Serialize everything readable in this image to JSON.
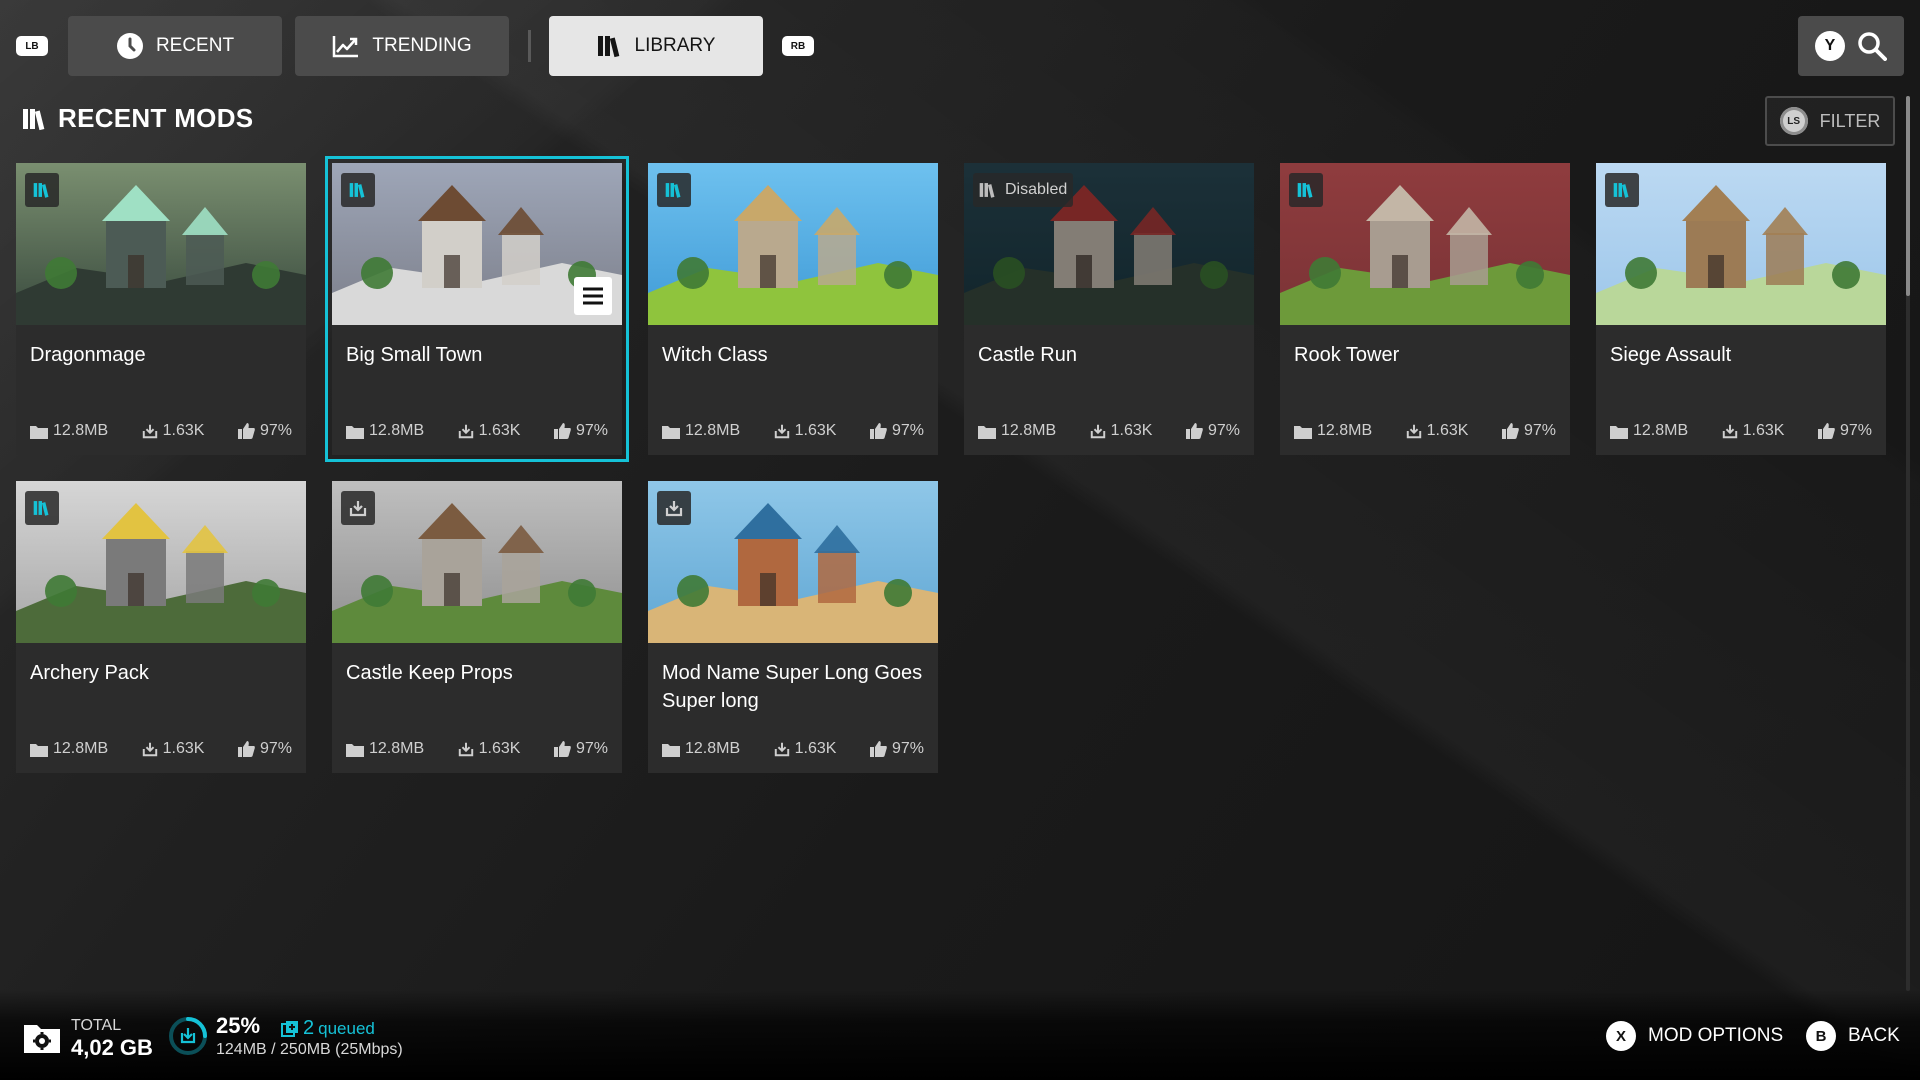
{
  "topbar": {
    "left_bumper": "LB",
    "right_bumper": "RB",
    "tabs": [
      {
        "label": "RECENT",
        "icon": "clock-icon",
        "active": false
      },
      {
        "label": "TRENDING",
        "icon": "trending-chart-icon",
        "active": false
      },
      {
        "label": "LIBRARY",
        "icon": "library-books-icon",
        "active": true
      }
    ],
    "search_button_glyph": "Y"
  },
  "section": {
    "title": "RECENT MODS",
    "filter_label": "FILTER",
    "filter_glyph": "LS"
  },
  "mods": [
    {
      "name": "Dragonmage",
      "size": "12.8MB",
      "downloads": "1.63K",
      "rating": "97%",
      "badge": "library",
      "theme": "dragon"
    },
    {
      "name": "Big Small Town",
      "size": "12.8MB",
      "downloads": "1.63K",
      "rating": "97%",
      "badge": "library",
      "theme": "town",
      "selected": true
    },
    {
      "name": "Witch Class",
      "size": "12.8MB",
      "downloads": "1.63K",
      "rating": "97%",
      "badge": "library",
      "theme": "witch"
    },
    {
      "name": "Castle Run",
      "size": "12.8MB",
      "downloads": "1.63K",
      "rating": "97%",
      "badge": "disabled",
      "badge_text": "Disabled",
      "theme": "castle"
    },
    {
      "name": "Rook Tower",
      "size": "12.8MB",
      "downloads": "1.63K",
      "rating": "97%",
      "badge": "library",
      "theme": "rook"
    },
    {
      "name": "Siege Assault",
      "size": "12.8MB",
      "downloads": "1.63K",
      "rating": "97%",
      "badge": "library",
      "theme": "siege"
    },
    {
      "name": "Archery Pack",
      "size": "12.8MB",
      "downloads": "1.63K",
      "rating": "97%",
      "badge": "library",
      "theme": "archery"
    },
    {
      "name": "Castle Keep Props",
      "size": "12.8MB",
      "downloads": "1.63K",
      "rating": "97%",
      "badge": "download",
      "theme": "keep"
    },
    {
      "name": "Mod Name Super Long Goes Super long",
      "size": "12.8MB",
      "downloads": "1.63K",
      "rating": "97%",
      "badge": "download",
      "theme": "pirate"
    }
  ],
  "bottombar": {
    "total_label": "TOTAL",
    "total_value": "4,02 GB",
    "download_percent": "25%",
    "progress_fraction": 0.25,
    "queued_count": "2",
    "queued_text": "queued",
    "download_detail": "124MB / 250MB (25Mbps)",
    "mod_options_glyph": "X",
    "mod_options_label": "MOD OPTIONS",
    "back_glyph": "B",
    "back_label": "BACK"
  },
  "colors": {
    "accent": "#15c2d7",
    "tab_bg": "#4b4b4b",
    "tab_active_bg": "#e6e6e6",
    "card_bg": "#2c2c2c"
  }
}
